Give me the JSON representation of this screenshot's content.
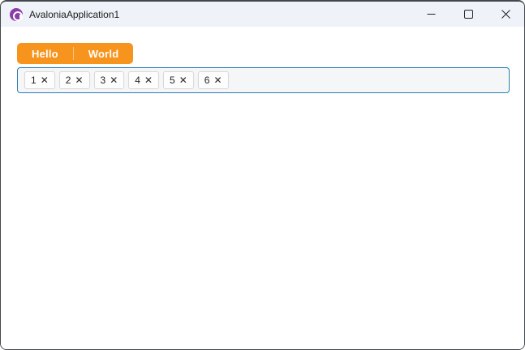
{
  "window": {
    "title": "AvaloniaApplication1",
    "app_icon": "avalonia-logo-icon",
    "controls": [
      {
        "name": "minimize",
        "icon": "minimize-icon"
      },
      {
        "name": "maximize",
        "icon": "maximize-icon"
      },
      {
        "name": "close",
        "icon": "close-icon"
      }
    ]
  },
  "tabs": {
    "items": [
      {
        "label": "Hello",
        "selected": true
      },
      {
        "label": "World",
        "selected": false
      }
    ]
  },
  "chips": {
    "remove_glyph": "✕",
    "items": [
      {
        "label": "1"
      },
      {
        "label": "2"
      },
      {
        "label": "3"
      },
      {
        "label": "4"
      },
      {
        "label": "5"
      },
      {
        "label": "6"
      }
    ]
  },
  "colors": {
    "accent_orange": "#F7941D",
    "box_border_blue": "#2E7CB0",
    "titlebar_bg": "#EFF3F9",
    "app_icon_purple": "#8B3DA8"
  }
}
